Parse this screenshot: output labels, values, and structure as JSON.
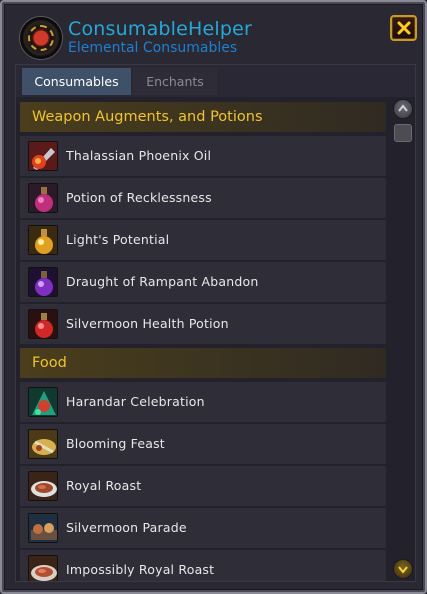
{
  "header": {
    "title": "ConsumableHelper",
    "subtitle": "Elemental Consumables"
  },
  "tabs": [
    {
      "label": "Consumables",
      "active": true
    },
    {
      "label": "Enchants",
      "active": false
    }
  ],
  "sections": [
    {
      "title": "Weapon Augments, and Potions",
      "items": [
        {
          "label": "Thalassian Phoenix Oil",
          "icon": "phoenix-oil-icon"
        },
        {
          "label": "Potion of Recklessness",
          "icon": "recklessness-potion-icon"
        },
        {
          "label": "Light's Potential",
          "icon": "lights-potential-icon"
        },
        {
          "label": "Draught of Rampant Abandon",
          "icon": "rampant-abandon-icon"
        },
        {
          "label": "Silvermoon Health Potion",
          "icon": "health-potion-icon"
        }
      ]
    },
    {
      "title": "Food",
      "items": [
        {
          "label": "Harandar Celebration",
          "icon": "harandar-celebration-icon"
        },
        {
          "label": "Blooming Feast",
          "icon": "blooming-feast-icon"
        },
        {
          "label": "Royal Roast",
          "icon": "royal-roast-icon"
        },
        {
          "label": "Silvermoon Parade",
          "icon": "silvermoon-parade-icon"
        },
        {
          "label": "Impossibly Royal Roast",
          "icon": "impossibly-royal-roast-icon"
        }
      ]
    }
  ],
  "colors": {
    "title": "#24a9d8",
    "subtitle": "#1f7fd0",
    "section_header_text": "#f0c430",
    "active_tab": "#3e5168"
  }
}
